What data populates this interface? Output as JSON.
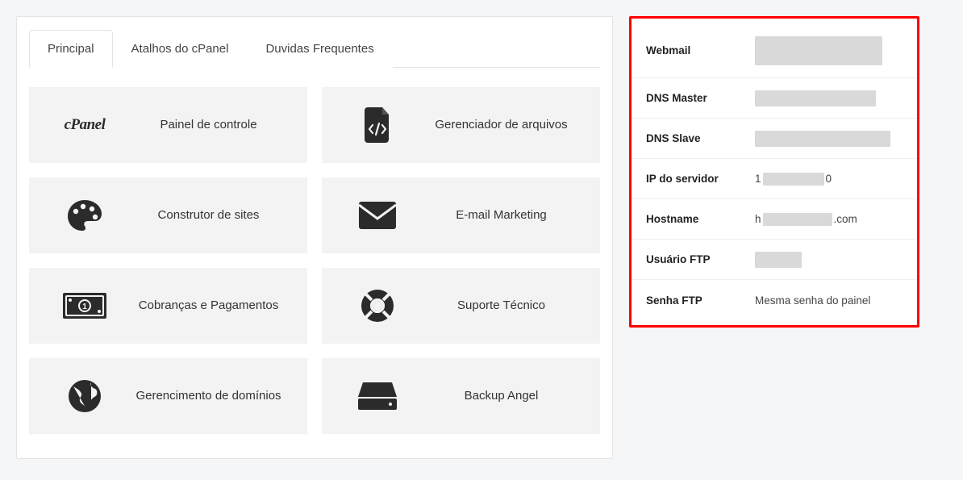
{
  "tabs": [
    {
      "label": "Principal",
      "active": true
    },
    {
      "label": "Atalhos do cPanel",
      "active": false
    },
    {
      "label": "Duvidas Frequentes",
      "active": false
    }
  ],
  "tiles": [
    {
      "icon": "cpanel-logo",
      "label": "Painel de controle"
    },
    {
      "icon": "code-file",
      "label": "Gerenciador de arquivos"
    },
    {
      "icon": "palette",
      "label": "Construtor de sites"
    },
    {
      "icon": "envelope",
      "label": "E-mail Marketing"
    },
    {
      "icon": "money-bill",
      "label": "Cobranças e Pagamentos"
    },
    {
      "icon": "life-ring",
      "label": "Suporte Técnico"
    },
    {
      "icon": "globe",
      "label": "Gerencimento de domínios"
    },
    {
      "icon": "hard-drive",
      "label": "Backup Angel"
    }
  ],
  "serverInfo": [
    {
      "label": "Webmail",
      "type": "redacted-large"
    },
    {
      "label": "DNS Master",
      "type": "redacted"
    },
    {
      "label": "DNS Slave",
      "type": "redacted-wide"
    },
    {
      "label": "IP do servidor",
      "type": "masked-ip",
      "prefix": "1",
      "suffix": "0"
    },
    {
      "label": "Hostname",
      "type": "masked-host",
      "prefix": "h",
      "suffix": ".com"
    },
    {
      "label": "Usuário FTP",
      "type": "redacted-small"
    },
    {
      "label": "Senha FTP",
      "type": "text",
      "value": "Mesma senha do painel"
    }
  ]
}
